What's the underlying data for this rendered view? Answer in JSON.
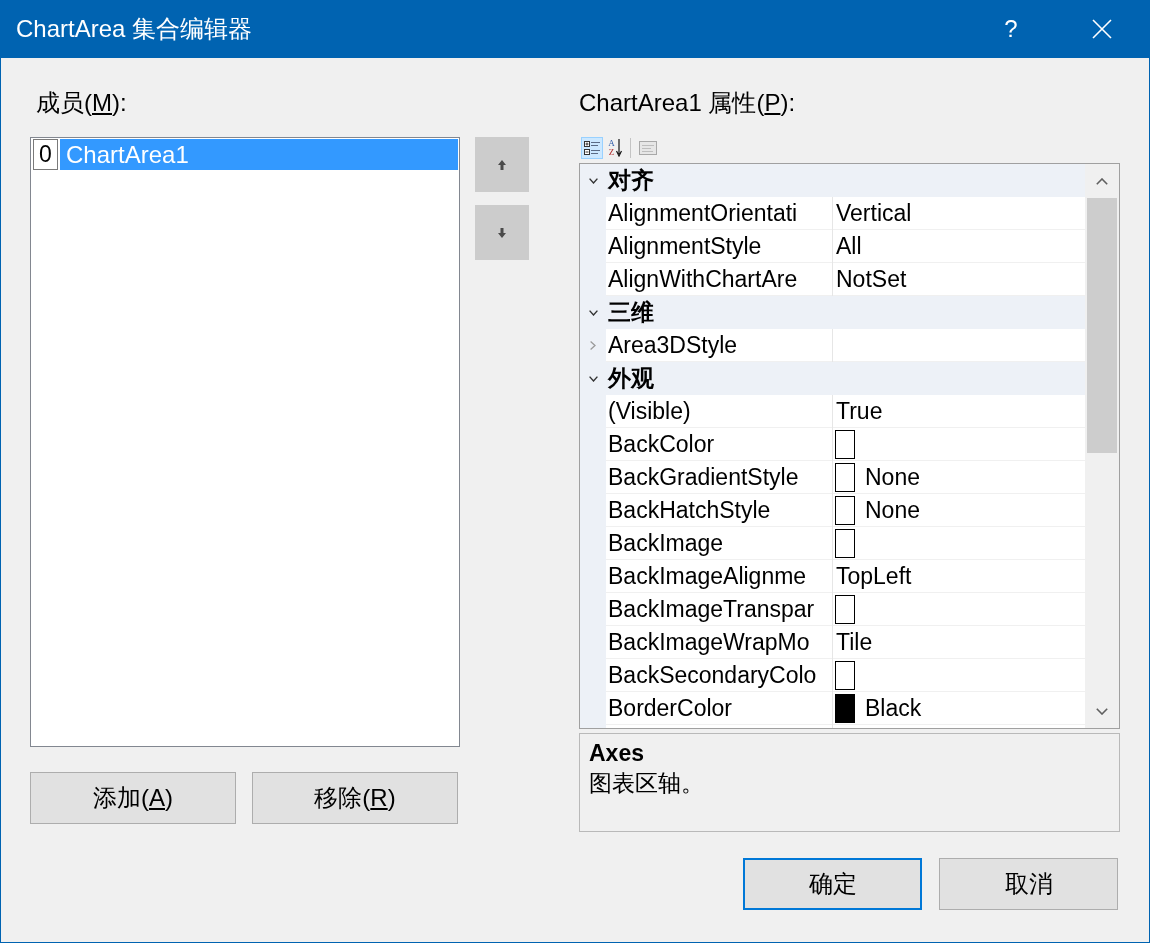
{
  "window": {
    "title": "ChartArea 集合编辑器",
    "help_button": "?"
  },
  "members": {
    "label": {
      "start": "成员(",
      "access_key": "M",
      "end": "):"
    },
    "items": [
      {
        "index": "0",
        "name": "ChartArea1",
        "selected": true
      }
    ],
    "move_buttons": [
      {
        "kind": "up"
      },
      {
        "kind": "down"
      }
    ],
    "buttons": [
      {
        "start": "添加(",
        "access_key": "A",
        "end": ")"
      },
      {
        "start": "移除(",
        "access_key": "R",
        "end": ")"
      }
    ]
  },
  "properties": {
    "label": {
      "start": "ChartArea1 属性(",
      "access_key": "P",
      "end": "):"
    },
    "toolbar": [
      {
        "kind": "categorized",
        "selected": true,
        "disabled": false
      },
      {
        "kind": "alphabetical",
        "selected": false,
        "disabled": false,
        "glyphs": [
          "A",
          "Z"
        ]
      },
      {
        "kind": "property_pages",
        "selected": false,
        "disabled": true
      }
    ],
    "categories": [
      {
        "name": "对齐",
        "expanded": true,
        "properties": [
          {
            "name": "AlignmentOrientati",
            "value": "Vertical"
          },
          {
            "name": "AlignmentStyle",
            "value": "All"
          },
          {
            "name": "AlignWithChartAre",
            "value": "NotSet"
          }
        ]
      },
      {
        "name": "三维",
        "expanded": true,
        "properties": [
          {
            "name": "Area3DStyle",
            "expanded": false
          }
        ]
      },
      {
        "name": "外观",
        "expanded": true,
        "properties": [
          {
            "name": "(Visible)",
            "value": "True"
          },
          {
            "name": "BackColor",
            "color": "#ffffff"
          },
          {
            "name": "BackGradientStyle",
            "color": "#ffffff",
            "value": "None"
          },
          {
            "name": "BackHatchStyle",
            "color": "#ffffff",
            "value": "None"
          },
          {
            "name": "BackImage",
            "color": "#ffffff"
          },
          {
            "name": "BackImageAlignme",
            "value": "TopLeft"
          },
          {
            "name": "BackImageTranspar",
            "color": "#ffffff"
          },
          {
            "name": "BackImageWrapMo",
            "value": "Tile"
          },
          {
            "name": "BackSecondaryColo",
            "color": "#ffffff"
          },
          {
            "name": "BorderColor",
            "color": "#000000",
            "value": "Black"
          }
        ]
      }
    ],
    "description": {
      "title": "Axes",
      "text": "图表区轴。"
    }
  },
  "buttons": [
    {
      "label": "确定",
      "default": true
    },
    {
      "label": "取消",
      "default": false
    }
  ]
}
